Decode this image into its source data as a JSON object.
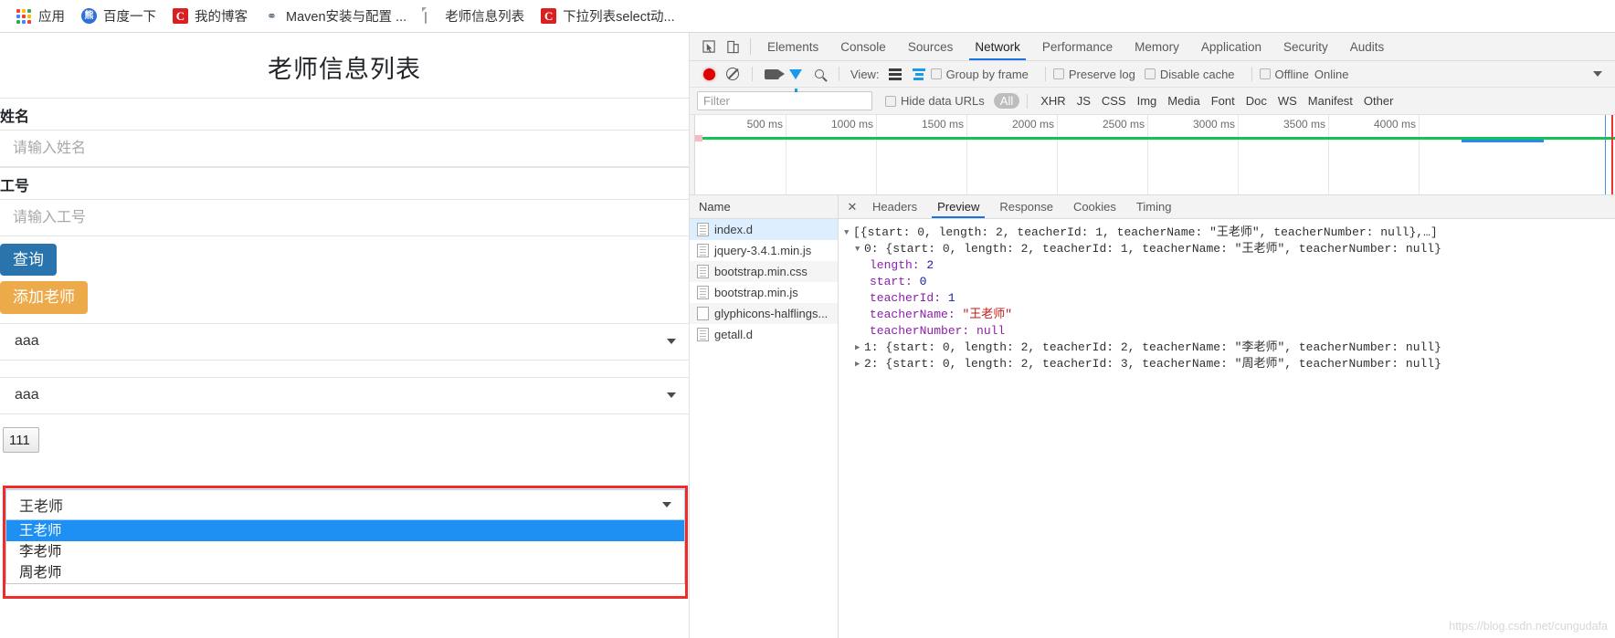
{
  "bookmarks": [
    {
      "label": "应用",
      "icon": "apps-grid-icon"
    },
    {
      "label": "百度一下",
      "icon": "baidu-icon"
    },
    {
      "label": "我的博客",
      "icon": "csdn-icon"
    },
    {
      "label": "Maven安装与配置 ...",
      "icon": "maven-icon"
    },
    {
      "label": "老师信息列表",
      "icon": "document-icon"
    },
    {
      "label": "下拉列表select动...",
      "icon": "csdn-icon"
    }
  ],
  "page": {
    "title": "老师信息列表",
    "name_label": "姓名",
    "name_placeholder": "请输入姓名",
    "name_value": "",
    "number_label": "工号",
    "number_placeholder": "请输入工号",
    "number_value": "",
    "query_button": "查询",
    "add_button": "添加老师",
    "select1_value": "aaa",
    "select2_value": "aaa",
    "tiny_select_value": "111",
    "teacher_select_value": "王老师",
    "teacher_options": [
      "王老师",
      "李老师",
      "周老师"
    ],
    "selected_option_index": 0,
    "highlight_color": "#ef2b2b",
    "primary_color": "#2a74ad",
    "warning_color": "#edaa4a",
    "option_highlight_color": "#1e90f4"
  },
  "devtools": {
    "panel_tabs": [
      "Elements",
      "Console",
      "Sources",
      "Network",
      "Performance",
      "Memory",
      "Application",
      "Security",
      "Audits"
    ],
    "active_panel_tab": "Network",
    "toolbar": {
      "record_title": "record-button",
      "clear_title": "clear-button",
      "camera_title": "screenshot-button",
      "filter_title": "filter-button",
      "search_title": "search-button",
      "view_label": "View:",
      "group_by_frame": "Group by frame",
      "preserve_log": "Preserve log",
      "disable_cache": "Disable cache",
      "offline": "Offline",
      "online": "Online"
    },
    "filterbar": {
      "filter_placeholder": "Filter",
      "filter_value": "",
      "hide_data_urls": "Hide data URLs",
      "types": [
        "All",
        "XHR",
        "JS",
        "CSS",
        "Img",
        "Media",
        "Font",
        "Doc",
        "WS",
        "Manifest",
        "Other"
      ],
      "active_type": "All"
    },
    "timeline": {
      "ticks": [
        "500 ms",
        "1000 ms",
        "1500 ms",
        "2000 ms",
        "2500 ms",
        "3000 ms",
        "3500 ms",
        "4000 ms"
      ]
    },
    "files": {
      "header": "Name",
      "rows": [
        {
          "name": "index.d",
          "selected": true,
          "icon": "document-icon"
        },
        {
          "name": "jquery-3.4.1.min.js",
          "selected": false,
          "icon": "document-icon"
        },
        {
          "name": "bootstrap.min.css",
          "selected": false,
          "icon": "document-icon"
        },
        {
          "name": "bootstrap.min.js",
          "selected": false,
          "icon": "document-icon"
        },
        {
          "name": "glyphicons-halflings...",
          "selected": false,
          "icon": "file-icon"
        },
        {
          "name": "getall.d",
          "selected": false,
          "icon": "document-icon"
        }
      ]
    },
    "detail_tabs": [
      "Headers",
      "Preview",
      "Response",
      "Cookies",
      "Timing"
    ],
    "active_detail_tab": "Preview",
    "json": {
      "root": "[{start: 0, length: 2, teacherId: 1, teacherName: \"王老师\", teacherNumber: null},…]",
      "row0": "0: {start: 0, length: 2, teacherId: 1, teacherName: \"王老师\", teacherNumber: null}",
      "length_key": "length:",
      "length_val": "2",
      "start_key": "start:",
      "start_val": "0",
      "teacherId_key": "teacherId:",
      "teacherId_val": "1",
      "teacherName_key": "teacherName:",
      "teacherName_val": "\"王老师\"",
      "teacherNumber_key": "teacherNumber:",
      "teacherNumber_val": "null",
      "row1": "1: {start: 0, length: 2, teacherId: 2, teacherName: \"李老师\", teacherNumber: null}",
      "row2": "2: {start: 0, length: 2, teacherId: 3, teacherName: \"周老师\", teacherNumber: null}"
    }
  },
  "watermark": "https://blog.csdn.net/cungudafa"
}
